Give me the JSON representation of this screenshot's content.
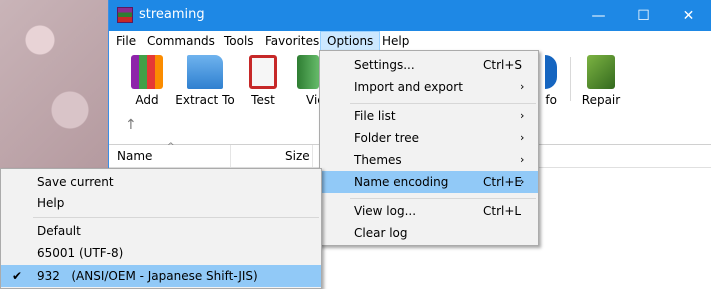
{
  "window": {
    "title": "streaming",
    "controls": {
      "minimize": "—",
      "maximize": "☐",
      "close": "✕"
    }
  },
  "menubar": [
    "File",
    "Commands",
    "Tools",
    "Favorites",
    "Options",
    "Help"
  ],
  "toolbar": {
    "buttons": [
      {
        "label": "Add",
        "icon": "archive-books-icon"
      },
      {
        "label": "Extract To",
        "icon": "folder-icon"
      },
      {
        "label": "Test",
        "icon": "clipboard-check-icon"
      },
      {
        "label": "Vie",
        "icon": "view-book-icon"
      },
      {
        "label": "fo",
        "icon": "info-icon"
      },
      {
        "label": "Repair",
        "icon": "repair-kit-icon"
      }
    ]
  },
  "file_list": {
    "columns": [
      "Name",
      "Size"
    ]
  },
  "options_menu": {
    "items": [
      {
        "label": "Settings...",
        "shortcut": "Ctrl+S"
      },
      {
        "label": "Import and export",
        "shortcut": ""
      },
      {
        "label": "File list",
        "shortcut": ""
      },
      {
        "label": "Folder tree",
        "shortcut": ""
      },
      {
        "label": "Themes",
        "shortcut": ""
      },
      {
        "label": "Name encoding",
        "shortcut": "Ctrl+E"
      },
      {
        "label": "View log...",
        "shortcut": "Ctrl+L"
      },
      {
        "label": "Clear log",
        "shortcut": ""
      }
    ]
  },
  "encoding_menu": {
    "items": [
      {
        "label": "Save current"
      },
      {
        "label": "Help"
      },
      {
        "label": "Default"
      },
      {
        "label": "65001 (UTF-8)"
      },
      {
        "label": "932   (ANSI/OEM - Japanese Shift-JIS)",
        "checked": true
      }
    ]
  },
  "colors": {
    "titlebar": "#1e88e5",
    "highlight": "#91c9f7"
  }
}
